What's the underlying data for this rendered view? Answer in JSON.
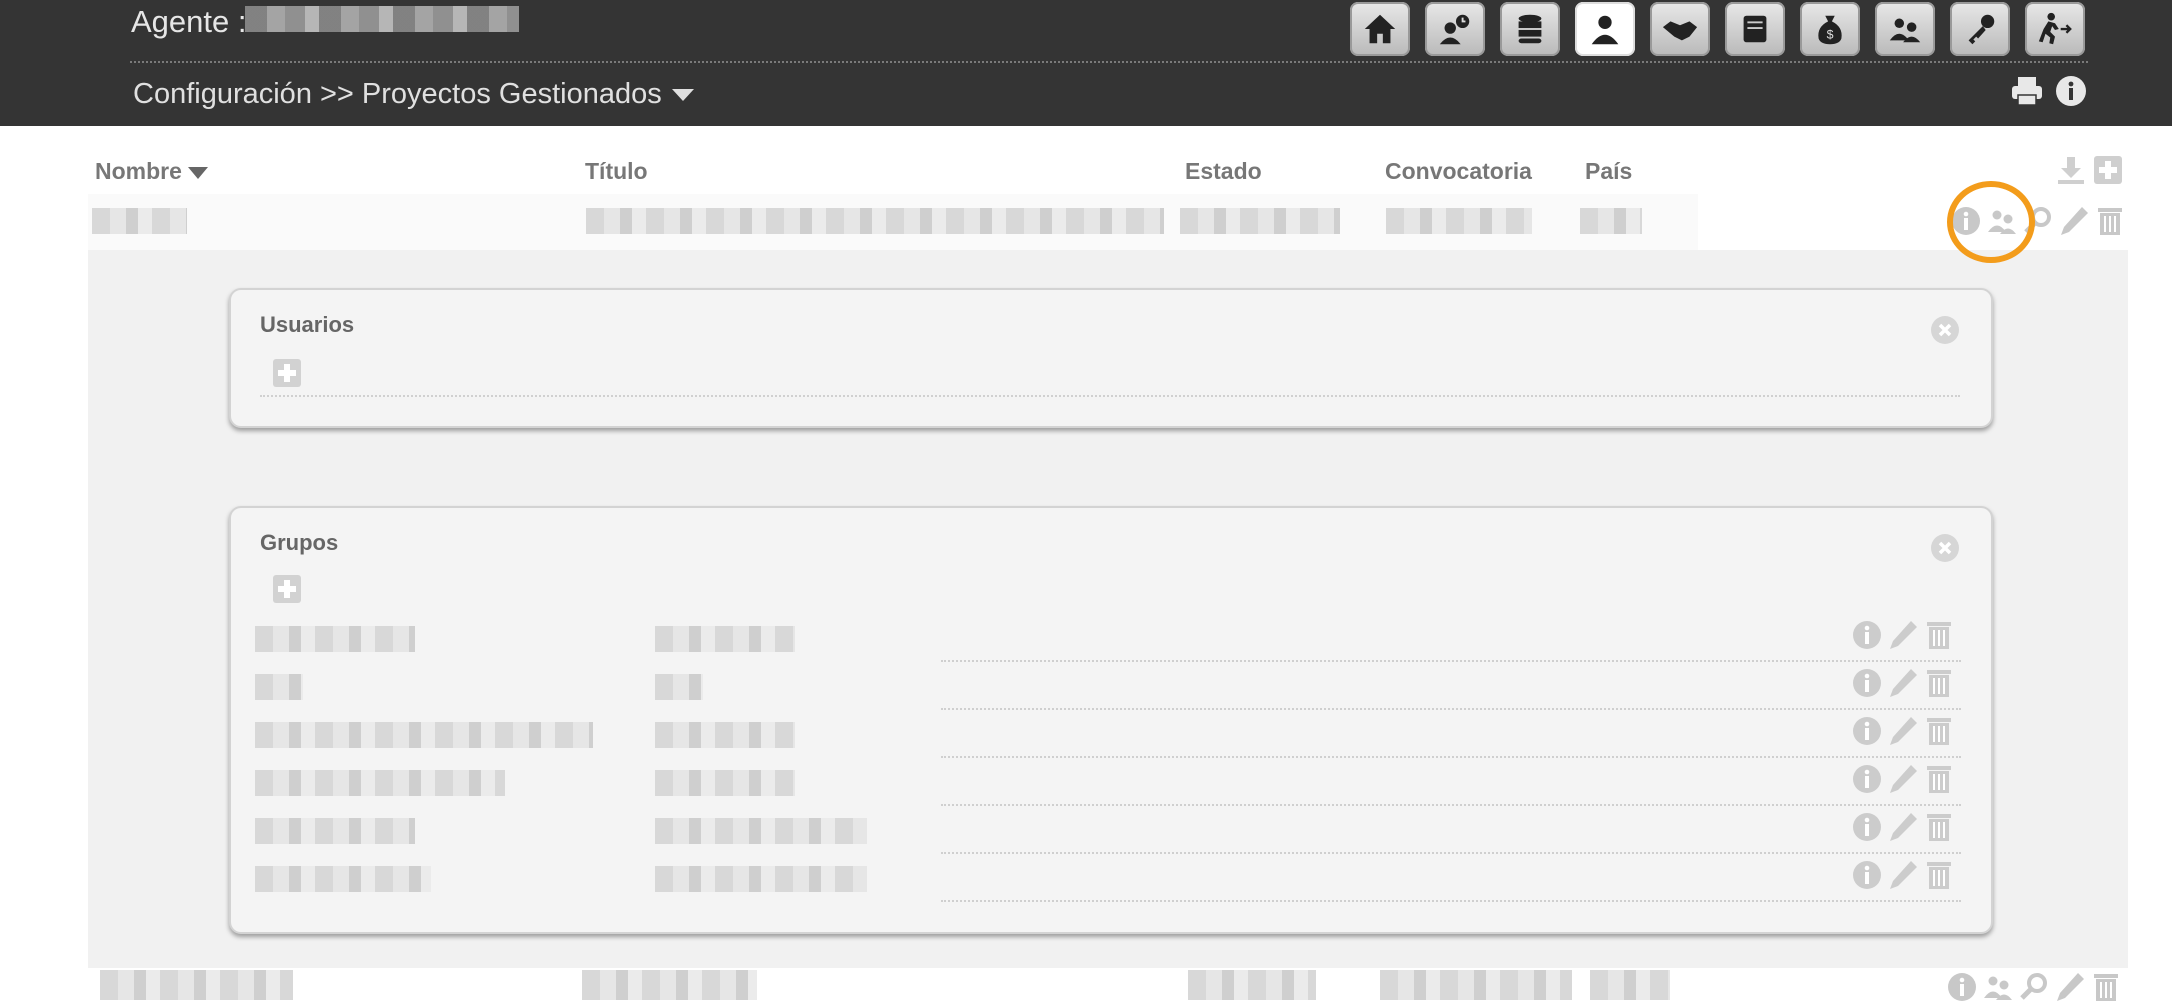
{
  "header": {
    "agent_label": "Agente :",
    "breadcrumb": "Configuración >> Proyectos Gestionados",
    "toolbar_icons": [
      "home-icon",
      "calendar-person-icon",
      "database-icon",
      "user-icon",
      "handshake-icon",
      "book-icon",
      "money-bag-icon",
      "users-icon",
      "key-icon",
      "exit-icon"
    ],
    "active_icon": "user-icon"
  },
  "table": {
    "columns": [
      {
        "label": "Nombre"
      },
      {
        "label": "Título"
      },
      {
        "label": "Estado"
      },
      {
        "label": "Convocatoria"
      },
      {
        "label": "País"
      }
    ]
  },
  "expanded": {
    "usuarios_title": "Usuarios",
    "grupos_title": "Grupos",
    "group_rows_count_visible": 6
  },
  "colors": {
    "topbar": "#343434",
    "highlight": "#f39c1b",
    "active_button": "#ffffff"
  }
}
